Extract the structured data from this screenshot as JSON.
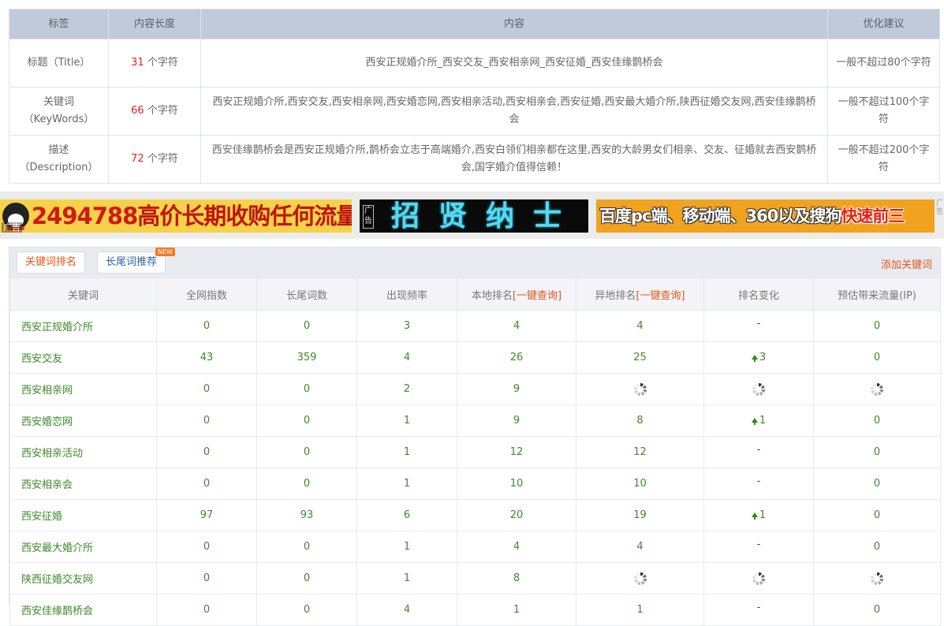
{
  "meta_table": {
    "headers": [
      "标签",
      "内容长度",
      "内容",
      "优化建议"
    ],
    "unit": "个字符",
    "rows": [
      {
        "label": "标题（Title）",
        "length": "31",
        "content": "西安正规婚介所_西安交友_西安相亲网_西安征婚_西安佳缘鹊桥会",
        "advice": "一般不超过80个字符"
      },
      {
        "label": "关键词（KeyWords）",
        "length": "66",
        "content": "西安正规婚介所,西安交友,西安相亲网,西安婚恋网,西安相亲活动,西安相亲会,西安征婚,西安最大婚介所,陕西征婚交友网,西安佳缘鹊桥会",
        "advice": "一般不超过100个字符"
      },
      {
        "label": "描述（Description）",
        "length": "72",
        "content": "西安佳缘鹊桥会是西安正规婚介所,鹊桥会立志于高端婚介,西安白领们相亲都在这里,西安的大龄男女们相亲、交友、征婚就去西安鹊桥会,国字婚介值得信赖！",
        "advice": "一般不超过200个字符"
      }
    ]
  },
  "ads": {
    "ad1": {
      "number": "2494788",
      "text": "高价长期收购任何流量",
      "tag": "广告"
    },
    "ad2": {
      "text": "招贤纳士",
      "tag": "广告"
    },
    "ad3": {
      "text_white": "百度pc端、移动端、360以及搜狗",
      "text_red": "快速前三"
    },
    "side_tag": "广告"
  },
  "keywords_panel": {
    "tabs": [
      "关键词排名",
      "长尾词推荐"
    ],
    "new_badge": "NEW",
    "add_link": "添加关键词",
    "headers": {
      "keyword": "关键词",
      "index": "全网指数",
      "longtail": "长尾词数",
      "frequency": "出现频率",
      "local_rank": "本地排名",
      "remote_rank": "异地排名",
      "query_link": "[一键查询]",
      "rank_change": "排名变化",
      "traffic": "预估带来流量(IP)"
    },
    "rows": [
      {
        "keyword": "西安正规婚介所",
        "index": "0",
        "longtail": "0",
        "frequency": "3",
        "local": "4",
        "remote": "4",
        "change": "-",
        "change_state": "none",
        "traffic": "0"
      },
      {
        "keyword": "西安交友",
        "index": "43",
        "longtail": "359",
        "frequency": "4",
        "local": "26",
        "remote": "25",
        "change": "3",
        "change_state": "up",
        "traffic": "0"
      },
      {
        "keyword": "西安相亲网",
        "index": "0",
        "longtail": "0",
        "frequency": "2",
        "local": "9",
        "remote": "loading",
        "change": "loading",
        "change_state": "loading",
        "traffic": "loading"
      },
      {
        "keyword": "西安婚恋网",
        "index": "0",
        "longtail": "0",
        "frequency": "1",
        "local": "9",
        "remote": "8",
        "change": "1",
        "change_state": "up",
        "traffic": "0"
      },
      {
        "keyword": "西安相亲活动",
        "index": "0",
        "longtail": "0",
        "frequency": "1",
        "local": "12",
        "remote": "12",
        "change": "-",
        "change_state": "none",
        "traffic": "0"
      },
      {
        "keyword": "西安相亲会",
        "index": "0",
        "longtail": "0",
        "frequency": "1",
        "local": "10",
        "remote": "10",
        "change": "-",
        "change_state": "none",
        "traffic": "0"
      },
      {
        "keyword": "西安征婚",
        "index": "97",
        "longtail": "93",
        "frequency": "6",
        "local": "20",
        "remote": "19",
        "change": "1",
        "change_state": "up",
        "traffic": "0"
      },
      {
        "keyword": "西安最大婚介所",
        "index": "0",
        "longtail": "0",
        "frequency": "1",
        "local": "4",
        "remote": "4",
        "change": "-",
        "change_state": "none",
        "traffic": "0"
      },
      {
        "keyword": "陕西征婚交友网",
        "index": "0",
        "longtail": "0",
        "frequency": "1",
        "local": "8",
        "remote": "loading",
        "change": "loading",
        "change_state": "loading",
        "traffic": "loading"
      },
      {
        "keyword": "西安佳缘鹊桥会",
        "index": "0",
        "longtail": "0",
        "frequency": "4",
        "local": "1",
        "remote": "1",
        "change": "-",
        "change_state": "none",
        "traffic": "0"
      }
    ]
  },
  "colors": {
    "accent_orange": "#e8541e",
    "value_green": "#3d8a2a",
    "count_red": "#e52121",
    "header_bg": "#c0cadb"
  }
}
